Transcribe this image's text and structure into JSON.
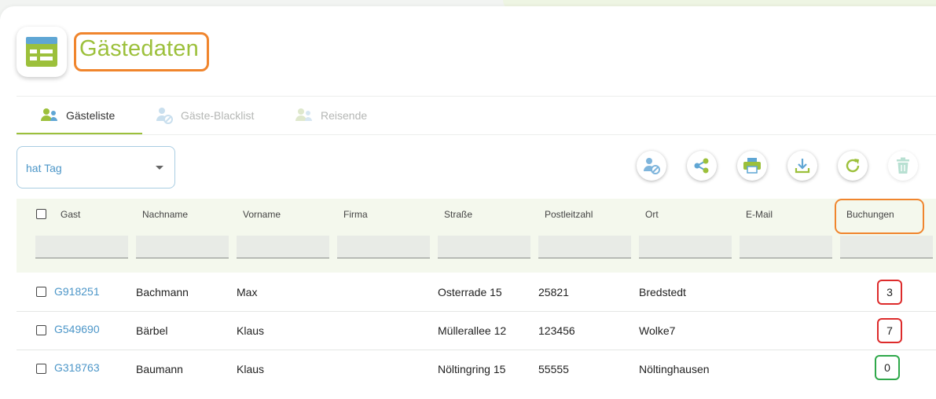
{
  "page": {
    "title": "Gästedaten"
  },
  "tabs": [
    {
      "label": "Gästeliste",
      "active": true
    },
    {
      "label": "Gäste-Blacklist",
      "active": false
    },
    {
      "label": "Reisende",
      "active": false
    }
  ],
  "filter_select": {
    "value": "hat Tag"
  },
  "toolbar": [
    {
      "icon": "user-block-icon",
      "enabled": true
    },
    {
      "icon": "share-icon",
      "enabled": true
    },
    {
      "icon": "print-icon",
      "enabled": true
    },
    {
      "icon": "download-icon",
      "enabled": true
    },
    {
      "icon": "refresh-icon",
      "enabled": true
    },
    {
      "icon": "trash-icon",
      "enabled": false
    }
  ],
  "table": {
    "columns": [
      "Gast",
      "Nachname",
      "Vorname",
      "Firma",
      "Straße",
      "Postleitzahl",
      "Ort",
      "E-Mail",
      "Buchungen"
    ],
    "rows": [
      {
        "gast": "G918251",
        "nachname": "Bachmann",
        "vorname": "Max",
        "firma": "",
        "strasse": "Osterrade 15",
        "plz": "25821",
        "ort": "Bredstedt",
        "email": "",
        "buchungen": "3"
      },
      {
        "gast": "G549690",
        "nachname": "Bärbel",
        "vorname": "Klaus",
        "firma": "",
        "strasse": "Müllerallee 12",
        "plz": "123456",
        "ort": "Wolke7",
        "email": "",
        "buchungen": "7"
      },
      {
        "gast": "G318763",
        "nachname": "Baumann",
        "vorname": "Klaus",
        "firma": "",
        "strasse": "Nöltingring 15",
        "plz": "55555",
        "ort": "Nöltinghausen",
        "email": "",
        "buchungen": "0"
      }
    ]
  },
  "colors": {
    "accent_green": "#9cc03b",
    "link_blue": "#4c96c8",
    "highlight_orange": "#f0852d",
    "highlight_red": "#dd2b2b",
    "highlight_green": "#2fa84a"
  }
}
